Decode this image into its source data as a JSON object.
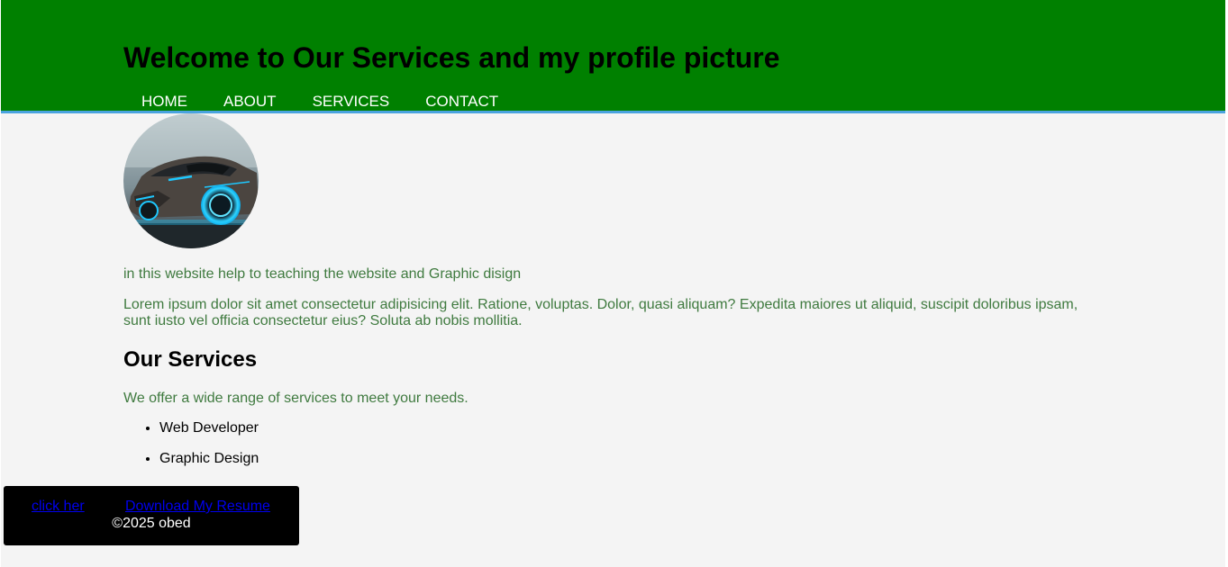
{
  "header": {
    "title": "Welcome to Our Services and my profile picture",
    "nav": [
      {
        "label": "HOME"
      },
      {
        "label": "ABOUT"
      },
      {
        "label": "SERVICES"
      },
      {
        "label": "CONTACT"
      }
    ]
  },
  "profile": {
    "image_description": "sports car profile picture"
  },
  "main": {
    "intro": "in this website help to teaching the website and Graphic disign",
    "lorem": "Lorem ipsum dolor sit amet consectetur adipisicing elit. Ratione, voluptas. Dolor, quasi aliquam? Expedita maiores ut aliquid, suscipit doloribus ipsam, sunt iusto vel officia consectetur eius? Soluta ab nobis mollitia.",
    "services_title": "Our Services",
    "services_intro": "We offer a wide range of services to meet your needs.",
    "services": [
      {
        "label": "Web Developer"
      },
      {
        "label": "Graphic Design"
      }
    ]
  },
  "footer": {
    "link_click": "click her",
    "link_resume": "Download My Resume",
    "copyright": "©2025 obed"
  },
  "colors": {
    "header_bg": "#008000",
    "header_border": "#4aa3df",
    "page_bg": "#f4f4f4",
    "paragraph_text": "#3f7a3f",
    "footer_bg": "#000000",
    "link": "#0000ee"
  }
}
